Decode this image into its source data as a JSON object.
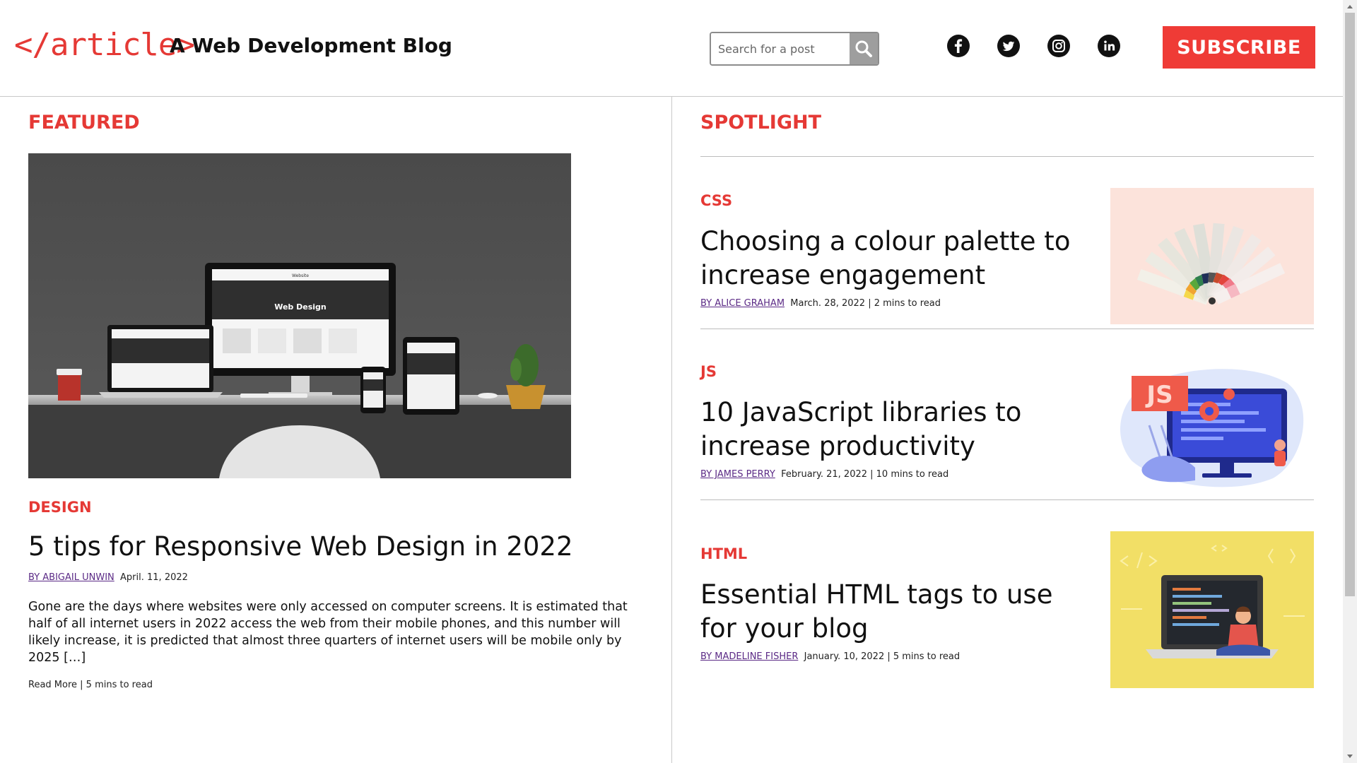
{
  "header": {
    "logo": "</article>",
    "tagline": "A Web Development Blog",
    "search_placeholder": "Search for a post",
    "search_icon": "search-icon",
    "social": [
      "facebook-icon",
      "twitter-icon",
      "instagram-icon",
      "linkedin-icon"
    ],
    "subscribe_label": "SUBSCRIBE"
  },
  "featured": {
    "section_title": "FEATURED",
    "category": "DESIGN",
    "title": "5 tips for Responsive Web Design in 2022",
    "author": "BY ABIGAIL UNWIN",
    "date": "April. 11, 2022",
    "excerpt": "Gone are the days where websites were only accessed on computer screens. It is estimated that half of all internet users in 2022 access the web from their mobile phones, and this number will likely increase, it is predicted that almost three quarters of internet users will be mobile only by 2025 […]",
    "read_more": "Read More | 5 mins to read",
    "image_text": "Web Design",
    "image_small_text": "Website"
  },
  "spotlight": {
    "section_title": "SPOTLIGHT",
    "posts": [
      {
        "category": "CSS",
        "title": "Choosing a colour palette to increase engagement",
        "author": "BY ALICE GRAHAM",
        "meta": "March. 28, 2022 | 2 mins to read"
      },
      {
        "category": "JS",
        "title": "10 JavaScript libraries to increase productivity",
        "author": "BY JAMES PERRY",
        "meta": "February. 21, 2022 | 10 mins to read",
        "image_badge": "JS"
      },
      {
        "category": "HTML",
        "title": "Essential HTML tags to use for your blog",
        "author": "BY MADELINE FISHER",
        "meta": "January. 10, 2022 | 5 mins to read"
      }
    ]
  },
  "colors": {
    "accent": "#e53935",
    "subscribe_bg": "#ef3b36",
    "author_link": "#5b2a86"
  }
}
